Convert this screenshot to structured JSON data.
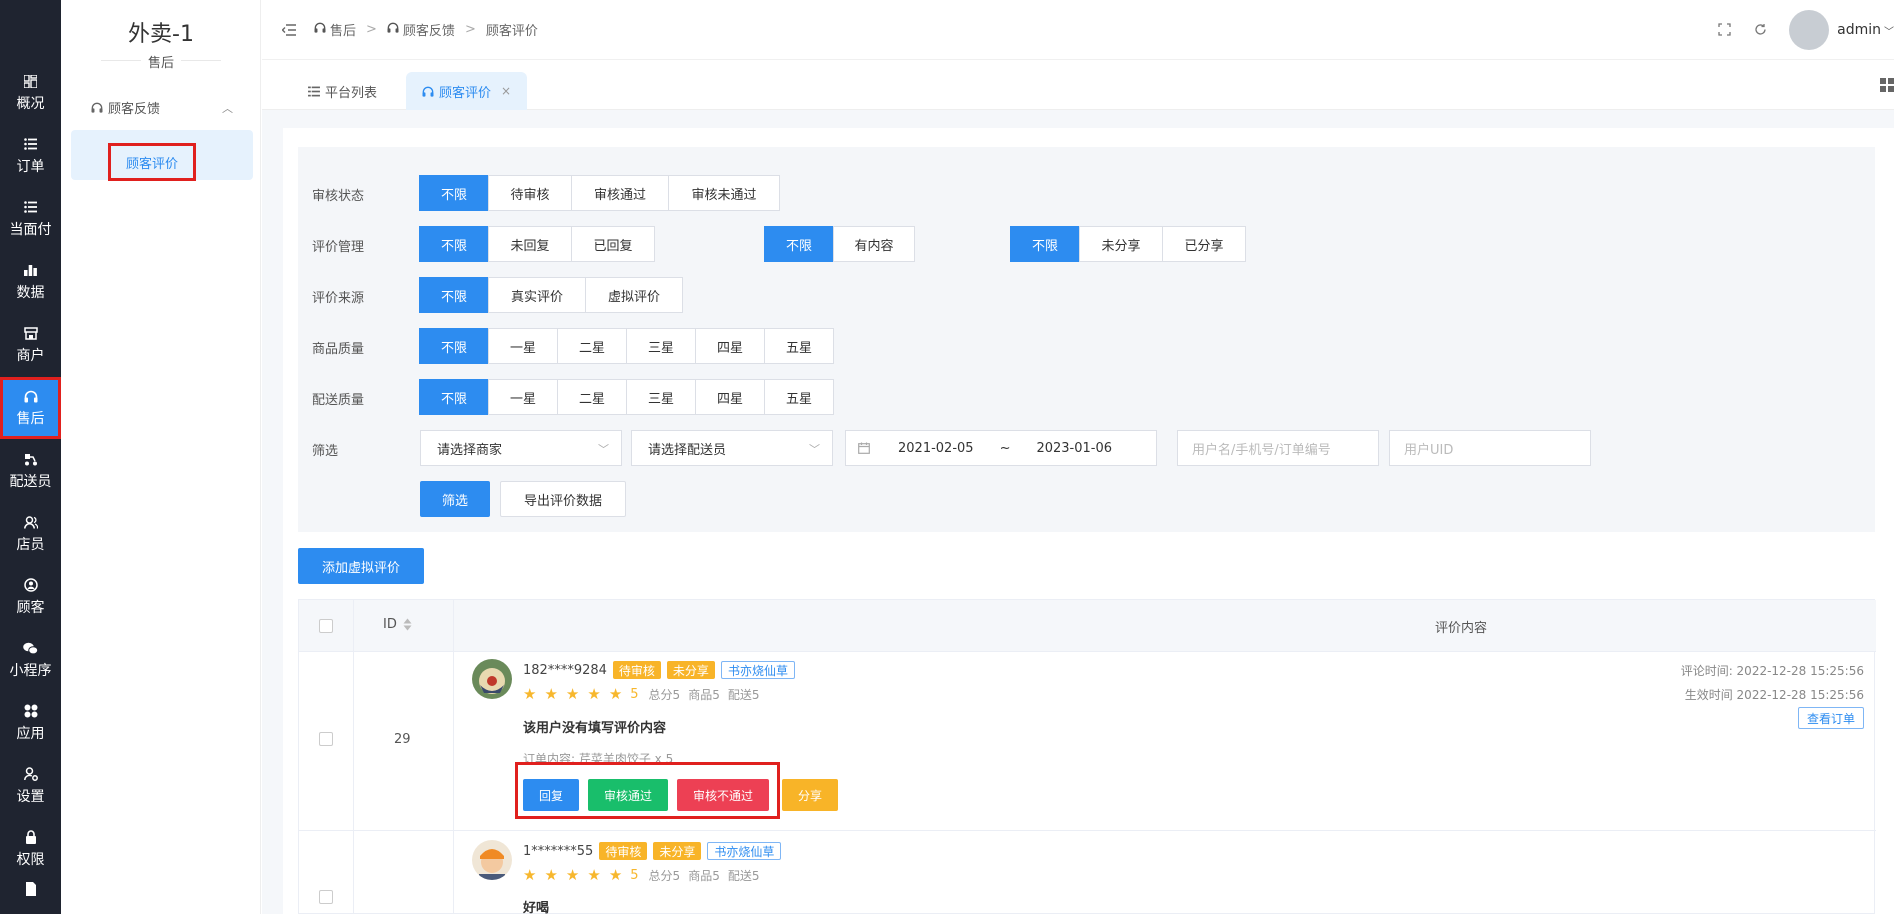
{
  "iconbar": {
    "items": [
      {
        "label": "概况",
        "icon": "dashboard-icon"
      },
      {
        "label": "订单",
        "icon": "list-icon"
      },
      {
        "label": "当面付",
        "icon": "list-icon"
      },
      {
        "label": "数据",
        "icon": "bar-chart-icon"
      },
      {
        "label": "商户",
        "icon": "store-icon"
      },
      {
        "label": "售后",
        "icon": "headphones-icon"
      },
      {
        "label": "配送员",
        "icon": "scooter-icon"
      },
      {
        "label": "店员",
        "icon": "users-icon"
      },
      {
        "label": "顾客",
        "icon": "user-circle-icon"
      },
      {
        "label": "小程序",
        "icon": "wechat-icon"
      },
      {
        "label": "应用",
        "icon": "apps-icon"
      },
      {
        "label": "设置",
        "icon": "user-gear-icon"
      },
      {
        "label": "权限",
        "icon": "lock-icon"
      }
    ],
    "active_index": 5
  },
  "sidebar": {
    "title": "外卖-1",
    "subtitle": "售后",
    "group": "顾客反馈",
    "item": "顾客评价"
  },
  "header": {
    "breadcrumb": [
      "售后",
      "顾客反馈",
      "顾客评价"
    ],
    "user": "admin"
  },
  "tabs": [
    {
      "label": "平台列表",
      "icon": "list-icon"
    },
    {
      "label": "顾客评价",
      "icon": "headphones-icon",
      "active": true
    }
  ],
  "filters": {
    "audit_status": {
      "label": "审核状态",
      "options": [
        "不限",
        "待审核",
        "审核通过",
        "审核未通过"
      ],
      "selected": 0
    },
    "review_mgmt": {
      "label": "评价管理",
      "options": [
        "不限",
        "未回复",
        "已回复"
      ],
      "selected": 0
    },
    "content_filter": {
      "options": [
        "不限",
        "有内容"
      ],
      "selected": 0
    },
    "share_filter": {
      "options": [
        "不限",
        "未分享",
        "已分享"
      ],
      "selected": 0
    },
    "review_source": {
      "label": "评价来源",
      "options": [
        "不限",
        "真实评价",
        "虚拟评价"
      ],
      "selected": 0
    },
    "product_quality": {
      "label": "商品质量",
      "options": [
        "不限",
        "一星",
        "二星",
        "三星",
        "四星",
        "五星"
      ],
      "selected": 0
    },
    "delivery_quality": {
      "label": "配送质量",
      "options": [
        "不限",
        "一星",
        "二星",
        "三星",
        "四星",
        "五星"
      ],
      "selected": 0
    },
    "screen": {
      "label": "筛选",
      "merchant_placeholder": "请选择商家",
      "courier_placeholder": "请选择配送员",
      "date_start": "2021-02-05",
      "date_sep": "~",
      "date_end": "2023-01-06",
      "query_placeholder": "用户名/手机号/订单编号",
      "uid_placeholder": "用户UID"
    },
    "filter_button": "筛选",
    "export_button": "导出评价数据"
  },
  "add_virtual_button": "添加虚拟评价",
  "table": {
    "headers": {
      "id": "ID",
      "content": "评价内容"
    },
    "rows": [
      {
        "id": "29",
        "user": "182****9284",
        "tags": [
          "待审核",
          "未分享",
          "书亦烧仙草"
        ],
        "rating": "5",
        "scores": [
          "总分5",
          "商品5",
          "配送5"
        ],
        "content": "该用户没有填写评价内容",
        "order_content": "订单内容: 芹菜羊肉饺子 x 5",
        "comment_time": "评论时间: 2022-12-28 15:25:56",
        "effective_time": "生效时间 2022-12-28 15:25:56",
        "view_order": "查看订单",
        "actions": [
          "回复",
          "审核通过",
          "审核不通过",
          "分享"
        ]
      },
      {
        "user": "1*******55",
        "tags": [
          "待审核",
          "未分享",
          "书亦烧仙草"
        ],
        "rating": "5",
        "scores": [
          "总分5",
          "商品5",
          "配送5"
        ],
        "content": "好喝"
      }
    ]
  },
  "colors": {
    "primary": "#2d8cf0",
    "success": "#19be6b",
    "danger": "#ed4054",
    "warning": "#f8b428",
    "highlight": "#e0201e",
    "iconbar_bg": "#1f2430"
  }
}
